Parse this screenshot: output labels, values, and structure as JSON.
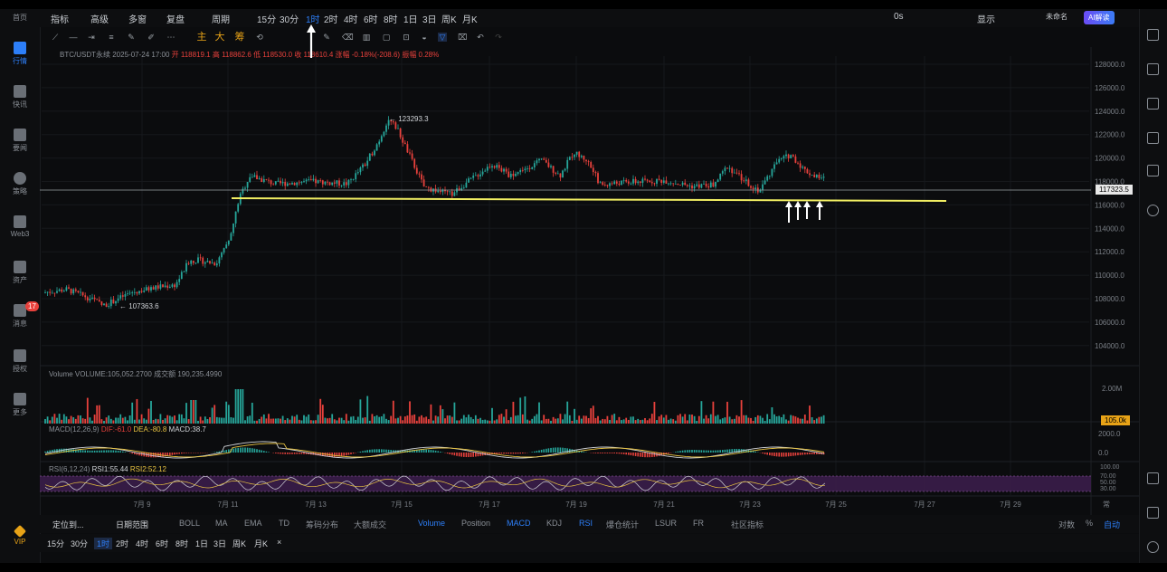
{
  "lside": {
    "items": [
      "首页",
      "行情",
      "快讯",
      "要闻",
      "策略",
      "Web3",
      "资产",
      "消息",
      "授权",
      "更多"
    ],
    "badge": "17",
    "vip": "VIP"
  },
  "topbar": {
    "items": [
      "指标",
      "高级",
      "多窗",
      "复盘",
      "周期",
      "15分",
      "30分",
      "1时",
      "2时",
      "4时",
      "6时",
      "8时",
      "1日",
      "3日",
      "周K",
      "月K"
    ],
    "right": [
      "0s",
      "显示",
      "未命名"
    ],
    "ai": "AI解读"
  },
  "toolbar": {
    "tools_y": [
      "主",
      "大",
      "筹"
    ]
  },
  "chart": {
    "info_symbol": "BTC/USDT永续",
    "info_time": "2025-07-24 17:00",
    "info_rest": "开 118819.1 高 118862.6 低 118530.0 收 118610.4 涨幅 -0.18%(-208.6) 振幅 0.28%",
    "high_label": "← 123293.3",
    "low_label": "← 107363.6",
    "price_ticks": [
      "128000.0",
      "126000.0",
      "124000.0",
      "122000.0",
      "120000.0",
      "118000.0",
      "116000.0",
      "114000.0",
      "112000.0",
      "110000.0",
      "108000.0",
      "106000.0",
      "104000.0"
    ],
    "last_price": "117323.5",
    "x_ticks": [
      "7月 9",
      "7月 11",
      "7月 13",
      "7月 15",
      "7月 17",
      "7月 19",
      "7月 21",
      "7月 23",
      "7月 25",
      "7月 27",
      "7月 29"
    ],
    "volume_label": "Volume",
    "volume_value": "VOLUME:105,052.2700",
    "volume_extra": "成交额 190,235.4990",
    "volume_tick": "2.00M",
    "volume_tag": "105.0k",
    "macd_label": "MACD(12,26,9)",
    "macd_dif": "DIF:-61.0",
    "macd_dea": "DEA:-80.8",
    "macd_val": "MACD:38.7",
    "macd_ticks": [
      "2000.0",
      "0.0"
    ],
    "rsi_label": "RSI(6,12,24)",
    "rsi1": "RSI1:55.44",
    "rsi2": "RSI2:52.12",
    "rsi_ticks": [
      "100.00",
      "70.00",
      "50.00",
      "30.00"
    ],
    "corner": "常"
  },
  "bottom1": {
    "items": [
      "定位到...",
      "日期范围",
      "BOLL",
      "MA",
      "EMA",
      "TD",
      "筹码分布",
      "大额成交",
      "Volume",
      "Position",
      "MACD",
      "KDJ",
      "RSI",
      "爆仓统计",
      "LSUR",
      "FR",
      "社区指标"
    ],
    "right": [
      "对数",
      "%",
      "自动"
    ]
  },
  "bottom2": {
    "items": [
      "15分",
      "30分",
      "1时",
      "2时",
      "4时",
      "6时",
      "8时",
      "1日",
      "3日",
      "周K",
      "月K",
      "×"
    ]
  },
  "colors": {
    "up": "#26a69a",
    "down": "#e8413c",
    "accent": "#2d7ff9",
    "support": "#f2ef63"
  }
}
